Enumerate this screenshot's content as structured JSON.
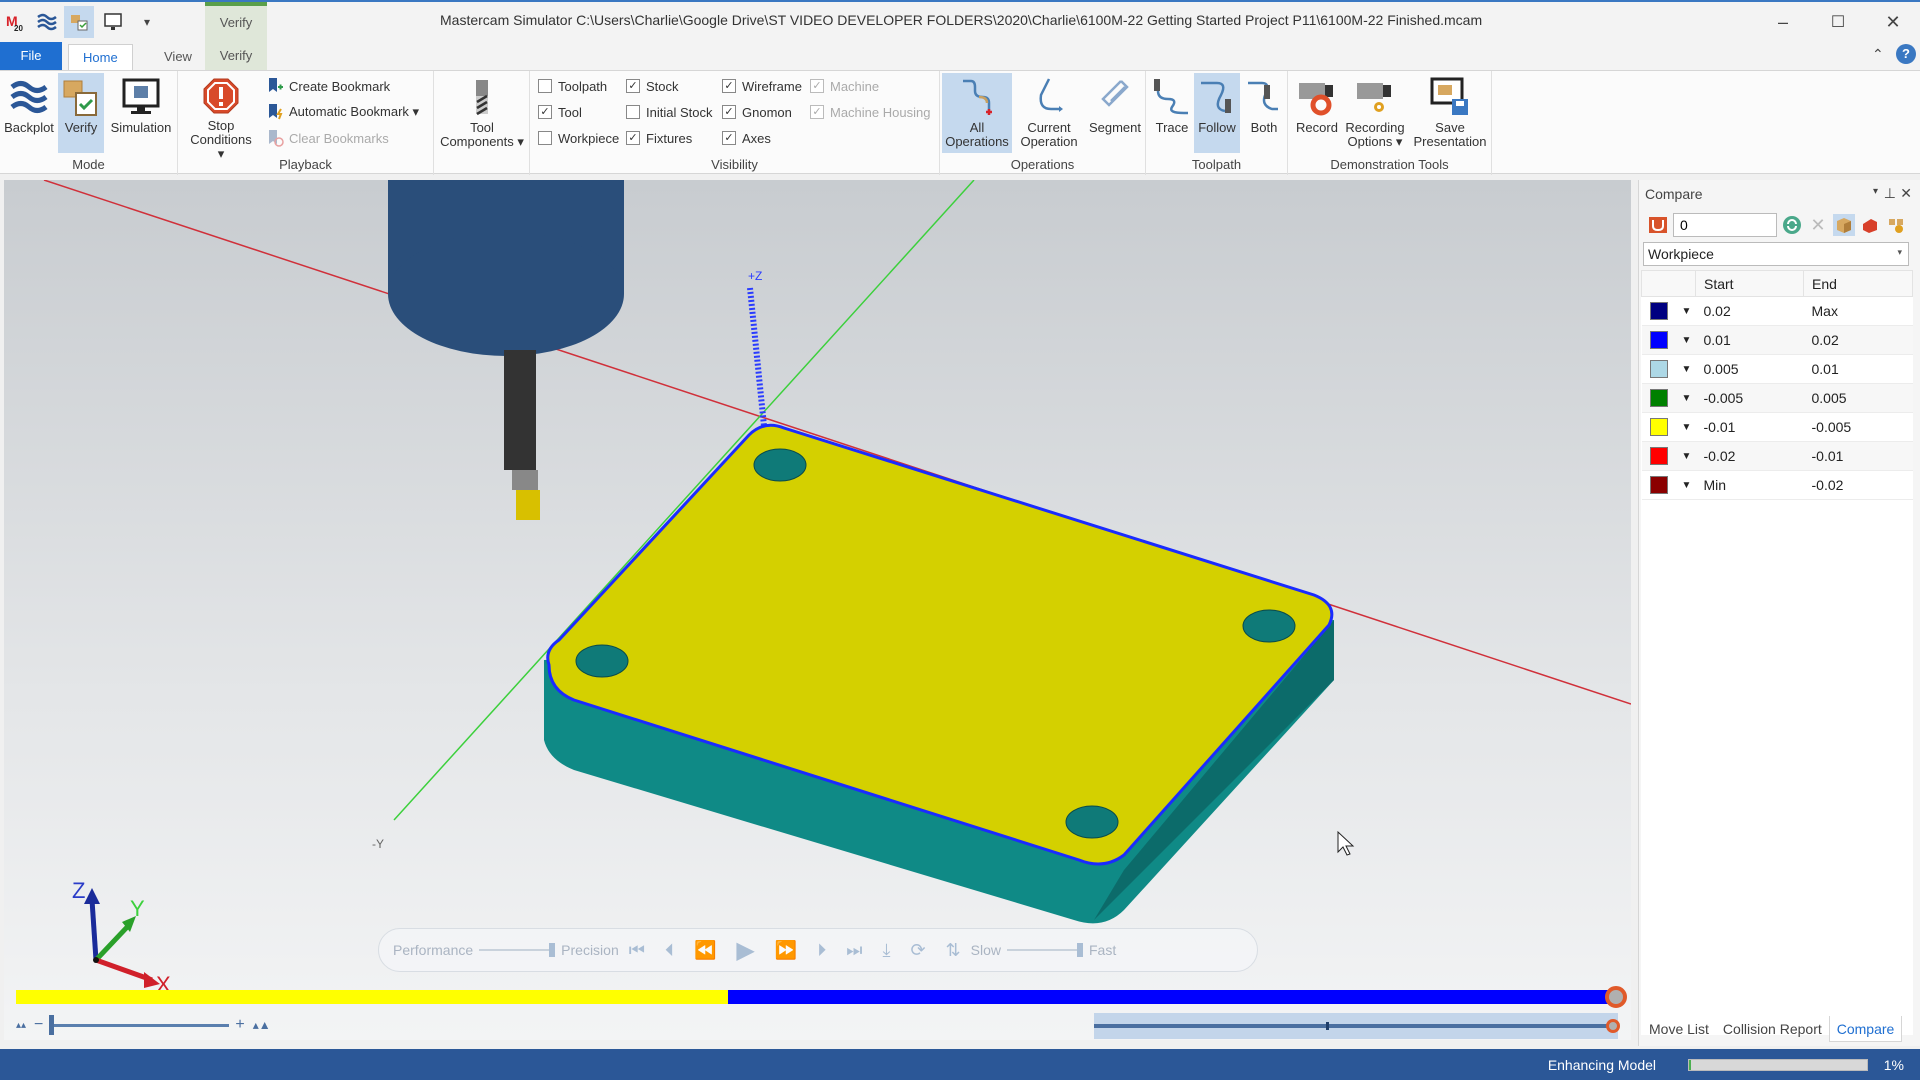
{
  "window": {
    "title": "Mastercam Simulator  C:\\Users\\Charlie\\Google Drive\\ST VIDEO DEVELOPER FOLDERS\\2020\\Charlie\\6100M-22 Getting Started Project P11\\6100M-22 Finished.mcam",
    "contextual_tab_group": "Verify",
    "minimize": "–",
    "maximize": "☐",
    "close": "✕"
  },
  "tabs": [
    {
      "label": "File"
    },
    {
      "label": "Home"
    },
    {
      "label": "View"
    },
    {
      "label": "Verify"
    }
  ],
  "ribbon": {
    "mode": {
      "label": "Mode",
      "buttons": [
        {
          "label": "Backplot"
        },
        {
          "label": "Verify",
          "active": true
        },
        {
          "label": "Simulation"
        }
      ]
    },
    "playback": {
      "label": "Playback",
      "stop_conditions": "Stop Conditions ▾",
      "create_bookmark": "Create Bookmark",
      "automatic_bookmark": "Automatic Bookmark ▾",
      "clear_bookmarks": "Clear Bookmarks"
    },
    "tool_components": {
      "label": "Tool Components ▾"
    },
    "visibility": {
      "label": "Visibility",
      "checks": [
        {
          "label": "Toolpath",
          "checked": false,
          "enabled": true
        },
        {
          "label": "Tool",
          "checked": true,
          "enabled": true
        },
        {
          "label": "Workpiece",
          "checked": false,
          "enabled": true
        },
        {
          "label": "Stock",
          "checked": true,
          "enabled": true
        },
        {
          "label": "Initial Stock",
          "checked": false,
          "enabled": true
        },
        {
          "label": "Fixtures",
          "checked": true,
          "enabled": true
        },
        {
          "label": "Wireframe",
          "checked": true,
          "enabled": true
        },
        {
          "label": "Gnomon",
          "checked": true,
          "enabled": true
        },
        {
          "label": "Axes",
          "checked": true,
          "enabled": true
        },
        {
          "label": "Machine",
          "checked": true,
          "enabled": false
        },
        {
          "label": "Machine Housing",
          "checked": true,
          "enabled": false
        }
      ]
    },
    "operations": {
      "label": "Operations",
      "buttons": [
        {
          "label": "All Operations",
          "active": true
        },
        {
          "label": "Current Operation"
        },
        {
          "label": "Segment"
        }
      ]
    },
    "toolpath": {
      "label": "Toolpath",
      "buttons": [
        {
          "label": "Trace"
        },
        {
          "label": "Follow",
          "active": true
        },
        {
          "label": "Both"
        }
      ]
    },
    "demo": {
      "label": "Demonstration Tools",
      "buttons": [
        {
          "label": "Record"
        },
        {
          "label": "Recording Options ▾"
        },
        {
          "label": "Save Presentation"
        }
      ]
    }
  },
  "viewport": {
    "axis_labels": {
      "plus_z": "+Z",
      "minus_y": "-Y"
    },
    "gnomon": {
      "x": "X",
      "y": "Y",
      "z": "Z"
    },
    "colors": {
      "top_face": "#d4d000",
      "side_face": "#0f8a86",
      "tool_body": "#2a4e7a",
      "edge": "#1a2bff",
      "x_axis": "#d0303a",
      "y_axis": "#3cd03c"
    }
  },
  "playbar": {
    "performance": "Performance",
    "precision": "Precision",
    "slow": "Slow",
    "fast": "Fast"
  },
  "progress": {
    "yellow_fraction": 0.445,
    "blue_fraction": 0.555,
    "colors": {
      "yellow": "#ffff00",
      "blue": "#0000ff"
    }
  },
  "compare_panel": {
    "title": "Compare",
    "tolerance_value": "0",
    "target": "Workpiece",
    "columns": [
      "",
      "Start",
      "End"
    ],
    "rows": [
      {
        "color": "#000080",
        "start": "0.02",
        "end": "Max"
      },
      {
        "color": "#0000ff",
        "start": "0.01",
        "end": "0.02"
      },
      {
        "color": "#add8e6",
        "start": "0.005",
        "end": "0.01"
      },
      {
        "color": "#008000",
        "start": "-0.005",
        "end": "0.005"
      },
      {
        "color": "#ffff00",
        "start": "-0.01",
        "end": "-0.005"
      },
      {
        "color": "#ff0000",
        "start": "-0.02",
        "end": "-0.01"
      },
      {
        "color": "#8b0000",
        "start": "Min",
        "end": "-0.02"
      }
    ],
    "tabs": [
      {
        "label": "Move List"
      },
      {
        "label": "Collision Report"
      },
      {
        "label": "Compare",
        "active": true
      }
    ]
  },
  "status": {
    "text": "Enhancing Model",
    "progress_percent": 1,
    "progress_label": "1%"
  }
}
